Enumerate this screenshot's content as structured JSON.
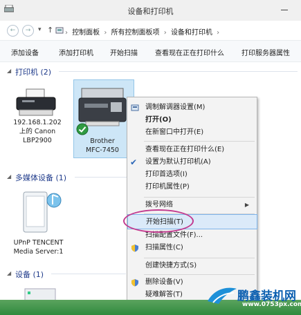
{
  "window": {
    "title": "设备和打印机"
  },
  "address": {
    "segments": [
      "控制面板",
      "所有控制面板项",
      "设备和打印机"
    ]
  },
  "toolbar": {
    "items": [
      "添加设备",
      "添加打印机",
      "开始扫描",
      "查看现在正在打印什么",
      "打印服务器属性"
    ]
  },
  "sections": {
    "printers": "打印机 (2)",
    "multimedia": "多媒体设备 (1)",
    "devices": "设备 (1)"
  },
  "devices": {
    "canon": [
      "192.168.1.202",
      "上的 Canon",
      "LBP2900"
    ],
    "brother": [
      "Brother",
      "MFC-7450"
    ],
    "upnp": [
      "UPnP TENCENT",
      "Media Server:1"
    ]
  },
  "context_menu": {
    "items": [
      "调制解调器设置(M)",
      "打开(O)",
      "在新窗口中打开(E)",
      "查看现在正在打印什么(E)",
      "设置为默认打印机(A)",
      "打印首选项(I)",
      "打印机属性(P)",
      "拨号网络",
      "开始扫描(T)",
      "扫描配置文件(F)...",
      "扫描属性(C)",
      "创建快捷方式(S)",
      "删除设备(V)",
      "疑难解答(T)"
    ]
  },
  "watermark": {
    "brand": "鹏鑫装机网",
    "url": "www.0753px.com"
  },
  "colors": {
    "accent": "#1e3a8a",
    "highlight": "#dbeaf9",
    "selection": "#cde6f7",
    "ring": "#c23a8f"
  }
}
